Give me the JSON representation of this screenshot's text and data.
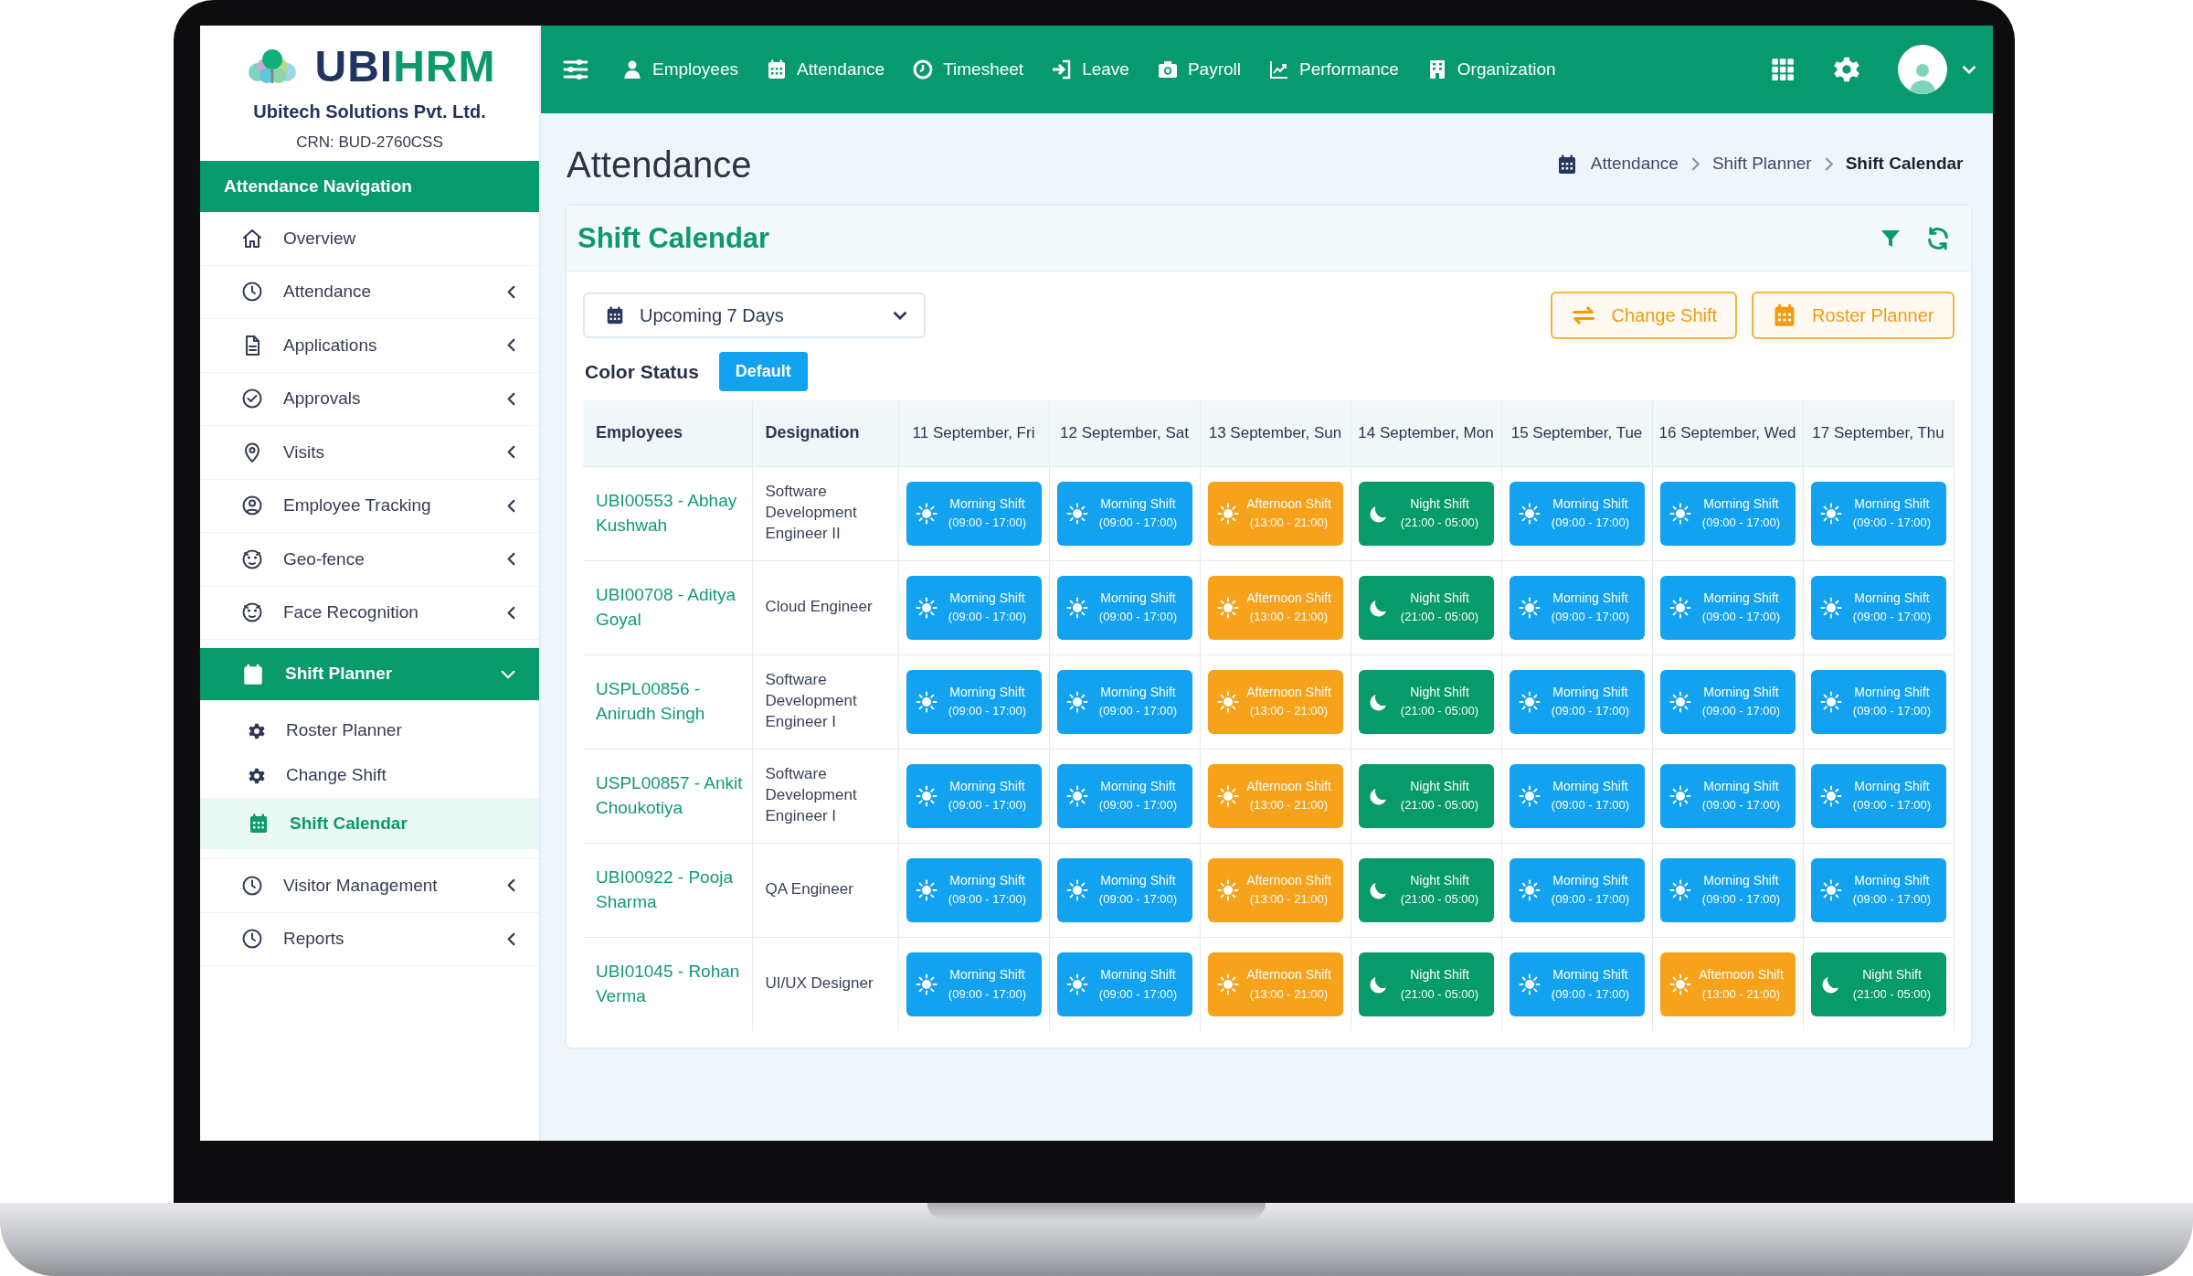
{
  "brand": {
    "logo_text": [
      "UBI",
      "HRM"
    ],
    "company": "Ubitech Solutions Pvt. Ltd.",
    "crn": "CRN: BUD-2760CSS"
  },
  "sidebar": {
    "header": "Attendance Navigation",
    "items": [
      {
        "label": "Overview",
        "kind": "link",
        "expanded": false
      },
      {
        "label": "Attendance",
        "kind": "group",
        "expanded": false
      },
      {
        "label": "Applications",
        "kind": "group",
        "expanded": false
      },
      {
        "label": "Approvals",
        "kind": "group",
        "expanded": false
      },
      {
        "label": "Visits",
        "kind": "group",
        "expanded": false
      },
      {
        "label": "Employee Tracking",
        "kind": "group",
        "expanded": false
      },
      {
        "label": "Geo-fence",
        "kind": "group",
        "expanded": false
      },
      {
        "label": "Face Recognition",
        "kind": "group",
        "expanded": false
      },
      {
        "label": "Shift Planner",
        "kind": "group",
        "expanded": true,
        "children": [
          {
            "label": "Roster Planner",
            "selected": false
          },
          {
            "label": "Change Shift",
            "selected": false
          },
          {
            "label": "Shift Calendar",
            "selected": true
          }
        ]
      },
      {
        "label": "Visitor Management",
        "kind": "group",
        "expanded": false
      },
      {
        "label": "Reports",
        "kind": "group",
        "expanded": false
      }
    ]
  },
  "topnav": {
    "items": [
      "Employees",
      "Attendance",
      "Timesheet",
      "Leave",
      "Payroll",
      "Performance",
      "Organization"
    ]
  },
  "page": {
    "title": "Attendance",
    "breadcrumb": [
      {
        "label": "Attendance",
        "current": false
      },
      {
        "label": "Shift Planner",
        "current": false
      },
      {
        "label": "Shift Calendar",
        "current": true
      }
    ]
  },
  "shift_calendar": {
    "title": "Shift Calendar",
    "range": {
      "value": "Upcoming 7 Days"
    },
    "actions": [
      "Change Shift",
      "Roster Planner"
    ],
    "color_status": {
      "label": "Color Status",
      "badge": "Default"
    },
    "columns": [
      "Employees",
      "Designation",
      "11 September, Fri",
      "12 September, Sat",
      "13 September, Sun",
      "14 September, Mon",
      "15 September, Tue",
      "16 September, Wed",
      "17 September, Thu"
    ],
    "rows": [
      {
        "employee": "UBI00553 - Abhay Kushwah",
        "designation": "Software Development Engineer II",
        "shifts": [
          {
            "kind": "morning",
            "name": "Morning Shift",
            "time": "(09:00 - 17:00)"
          },
          {
            "kind": "morning",
            "name": "Morning Shift",
            "time": "(09:00 - 17:00)"
          },
          {
            "kind": "afternoon",
            "name": "Afternoon Shift",
            "time": "(13:00 - 21:00)"
          },
          {
            "kind": "night",
            "name": "Night Shift",
            "time": "(21:00 - 05:00)"
          },
          {
            "kind": "morning",
            "name": "Morning Shift",
            "time": "(09:00 - 17:00)"
          },
          {
            "kind": "morning",
            "name": "Morning Shift",
            "time": "(09:00 - 17:00)"
          },
          {
            "kind": "morning",
            "name": "Morning Shift",
            "time": "(09:00 - 17:00)"
          }
        ]
      },
      {
        "employee": "UBI00708 - Aditya Goyal",
        "designation": "Cloud Engineer",
        "shifts": [
          {
            "kind": "morning",
            "name": "Morning Shift",
            "time": "(09:00 - 17:00)"
          },
          {
            "kind": "morning",
            "name": "Morning Shift",
            "time": "(09:00 - 17:00)"
          },
          {
            "kind": "afternoon",
            "name": "Afternoon Shift",
            "time": "(13:00 - 21:00)"
          },
          {
            "kind": "night",
            "name": "Night Shift",
            "time": "(21:00 - 05:00)"
          },
          {
            "kind": "morning",
            "name": "Morning Shift",
            "time": "(09:00 - 17:00)"
          },
          {
            "kind": "morning",
            "name": "Morning Shift",
            "time": "(09:00 - 17:00)"
          },
          {
            "kind": "morning",
            "name": "Morning Shift",
            "time": "(09:00 - 17:00)"
          }
        ]
      },
      {
        "employee": "USPL00856 - Anirudh Singh",
        "designation": "Software Development Engineer I",
        "shifts": [
          {
            "kind": "morning",
            "name": "Morning Shift",
            "time": "(09:00 - 17:00)"
          },
          {
            "kind": "morning",
            "name": "Morning Shift",
            "time": "(09:00 - 17:00)"
          },
          {
            "kind": "afternoon",
            "name": "Afternoon Shift",
            "time": "(13:00 - 21:00)"
          },
          {
            "kind": "night",
            "name": "Night Shift",
            "time": "(21:00 - 05:00)"
          },
          {
            "kind": "morning",
            "name": "Morning Shift",
            "time": "(09:00 - 17:00)"
          },
          {
            "kind": "morning",
            "name": "Morning Shift",
            "time": "(09:00 - 17:00)"
          },
          {
            "kind": "morning",
            "name": "Morning Shift",
            "time": "(09:00 - 17:00)"
          }
        ]
      },
      {
        "employee": "USPL00857 - Ankit Choukotiya",
        "designation": "Software Development Engineer I",
        "shifts": [
          {
            "kind": "morning",
            "name": "Morning Shift",
            "time": "(09:00 - 17:00)"
          },
          {
            "kind": "morning",
            "name": "Morning Shift",
            "time": "(09:00 - 17:00)"
          },
          {
            "kind": "afternoon",
            "name": "Afternoon Shift",
            "time": "(13:00 - 21:00)"
          },
          {
            "kind": "night",
            "name": "Night Shift",
            "time": "(21:00 - 05:00)"
          },
          {
            "kind": "morning",
            "name": "Morning Shift",
            "time": "(09:00 - 17:00)"
          },
          {
            "kind": "morning",
            "name": "Morning Shift",
            "time": "(09:00 - 17:00)"
          },
          {
            "kind": "morning",
            "name": "Morning Shift",
            "time": "(09:00 - 17:00)"
          }
        ]
      },
      {
        "employee": "UBI00922 - Pooja Sharma",
        "designation": "QA Engineer",
        "shifts": [
          {
            "kind": "morning",
            "name": "Morning Shift",
            "time": "(09:00 - 17:00)"
          },
          {
            "kind": "morning",
            "name": "Morning Shift",
            "time": "(09:00 - 17:00)"
          },
          {
            "kind": "afternoon",
            "name": "Afternoon Shift",
            "time": "(13:00 - 21:00)"
          },
          {
            "kind": "night",
            "name": "Night Shift",
            "time": "(21:00 - 05:00)"
          },
          {
            "kind": "morning",
            "name": "Morning Shift",
            "time": "(09:00 - 17:00)"
          },
          {
            "kind": "morning",
            "name": "Morning Shift",
            "time": "(09:00 - 17:00)"
          },
          {
            "kind": "morning",
            "name": "Morning Shift",
            "time": "(09:00 - 17:00)"
          }
        ]
      },
      {
        "employee": "UBI01045 - Rohan Verma",
        "designation": "UI/UX Designer",
        "shifts": [
          {
            "kind": "morning",
            "name": "Morning Shift",
            "time": "(09:00 - 17:00)"
          },
          {
            "kind": "morning",
            "name": "Morning Shift",
            "time": "(09:00 - 17:00)"
          },
          {
            "kind": "afternoon",
            "name": "Afternoon Shift",
            "time": "(13:00 - 21:00)"
          },
          {
            "kind": "night",
            "name": "Night Shift",
            "time": "(21:00 - 05:00)"
          },
          {
            "kind": "morning",
            "name": "Morning Shift",
            "time": "(09:00 - 17:00)"
          },
          {
            "kind": "afternoon",
            "name": "Afternoon Shift",
            "time": "(13:00 - 21:00)"
          },
          {
            "kind": "night",
            "name": "Night Shift",
            "time": "(21:00 - 05:00)"
          }
        ]
      }
    ]
  }
}
